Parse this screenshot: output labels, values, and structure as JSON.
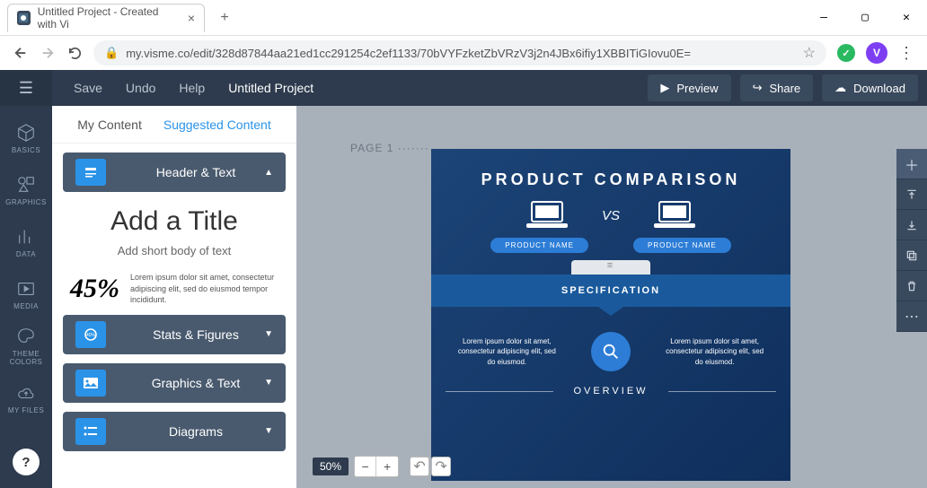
{
  "browser": {
    "tab_title": "Untitled Project - Created with Vi",
    "url": "my.visme.co/edit/328d87844aa21ed1cc291254c2ef1133/70bVYFzketZbVRzV3j2n4JBx6ifiy1XBBITiGIovu0E=",
    "avatar_initial": "V"
  },
  "app": {
    "menu": {
      "save": "Save",
      "undo": "Undo",
      "help": "Help"
    },
    "project_name": "Untitled Project",
    "buttons": {
      "preview": "Preview",
      "share": "Share",
      "download": "Download"
    }
  },
  "rail": {
    "items": [
      "BASICS",
      "GRAPHICS",
      "DATA",
      "MEDIA",
      "THEME COLORS",
      "MY FILES"
    ],
    "help": "?"
  },
  "panel": {
    "tabs": {
      "my": "My Content",
      "suggested": "Suggested Content"
    },
    "categories": [
      "Header & Text",
      "Stats & Figures",
      "Graphics & Text",
      "Diagrams"
    ],
    "preview": {
      "title": "Add a Title",
      "subtitle": "Add short body of text",
      "stat_pct": "45%",
      "stat_txt": "Lorem ipsum dolor sit amet, consectetur adipiscing elit, sed do eiusmod tempor incididunt.",
      "ring_label": "40%"
    }
  },
  "canvas": {
    "page_label": "PAGE 1",
    "zoom": "50%",
    "doc": {
      "title": "PRODUCT COMPARISON",
      "vs": "VS",
      "product_a": "PRODUCT NAME",
      "product_b": "PRODUCT NAME",
      "spec": "SPECIFICATION",
      "lorem": "Lorem ipsum dolor sit amet, consectetur adipiscing elit, sed do eiusmod.",
      "overview": "OVERVIEW"
    }
  }
}
